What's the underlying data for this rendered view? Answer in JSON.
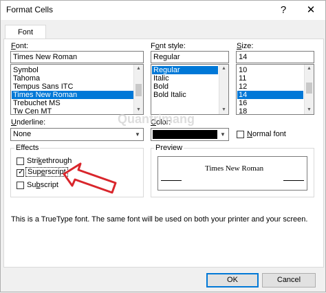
{
  "window": {
    "title": "Format Cells",
    "help_glyph": "?",
    "close_glyph": "✕"
  },
  "tabs": [
    {
      "label": "Font"
    }
  ],
  "font": {
    "label_prefix": "F",
    "label_rest": "ont:",
    "value": "Times New Roman",
    "items": [
      "Symbol",
      "Tahoma",
      "Tempus Sans ITC",
      "Times New Roman",
      "Trebuchet MS",
      "Tw Cen MT"
    ],
    "selected_index": 3
  },
  "font_style": {
    "label_pre": "F",
    "label_o": "o",
    "label_rest": "nt style:",
    "value": "Regular",
    "items": [
      "Regular",
      "Italic",
      "Bold",
      "Bold Italic"
    ],
    "selected_index": 0
  },
  "size": {
    "label_prefix": "S",
    "label_rest": "ize:",
    "value": "14",
    "items": [
      "10",
      "11",
      "12",
      "14",
      "16",
      "18"
    ],
    "selected_index": 3
  },
  "underline": {
    "label_prefix": "U",
    "label_rest": "nderline:",
    "value": "None"
  },
  "color": {
    "label_prefix": "C",
    "label_rest": "olor:",
    "swatch": "#000000"
  },
  "normal_font": {
    "label_prefix": "N",
    "label_rest": "ormal font",
    "checked": false
  },
  "effects": {
    "title": "Effects",
    "strikethrough": {
      "pre": "Stri",
      "ul": "k",
      "post": "ethrough",
      "checked": false
    },
    "superscript": {
      "pre": "Sup",
      "ul": "e",
      "post": "rscript",
      "checked": true
    },
    "subscript": {
      "pre": "Su",
      "ul": "b",
      "post": "script",
      "checked": false
    }
  },
  "preview": {
    "title": "Preview",
    "sample": "Times New Roman"
  },
  "info_text": "This is a TrueType font.  The same font will be used on both your printer and your screen.",
  "buttons": {
    "ok": "OK",
    "cancel": "Cancel"
  },
  "annotation": {
    "arrow_color": "#d9262c"
  },
  "watermark": {
    "text": "Quantrimang"
  }
}
